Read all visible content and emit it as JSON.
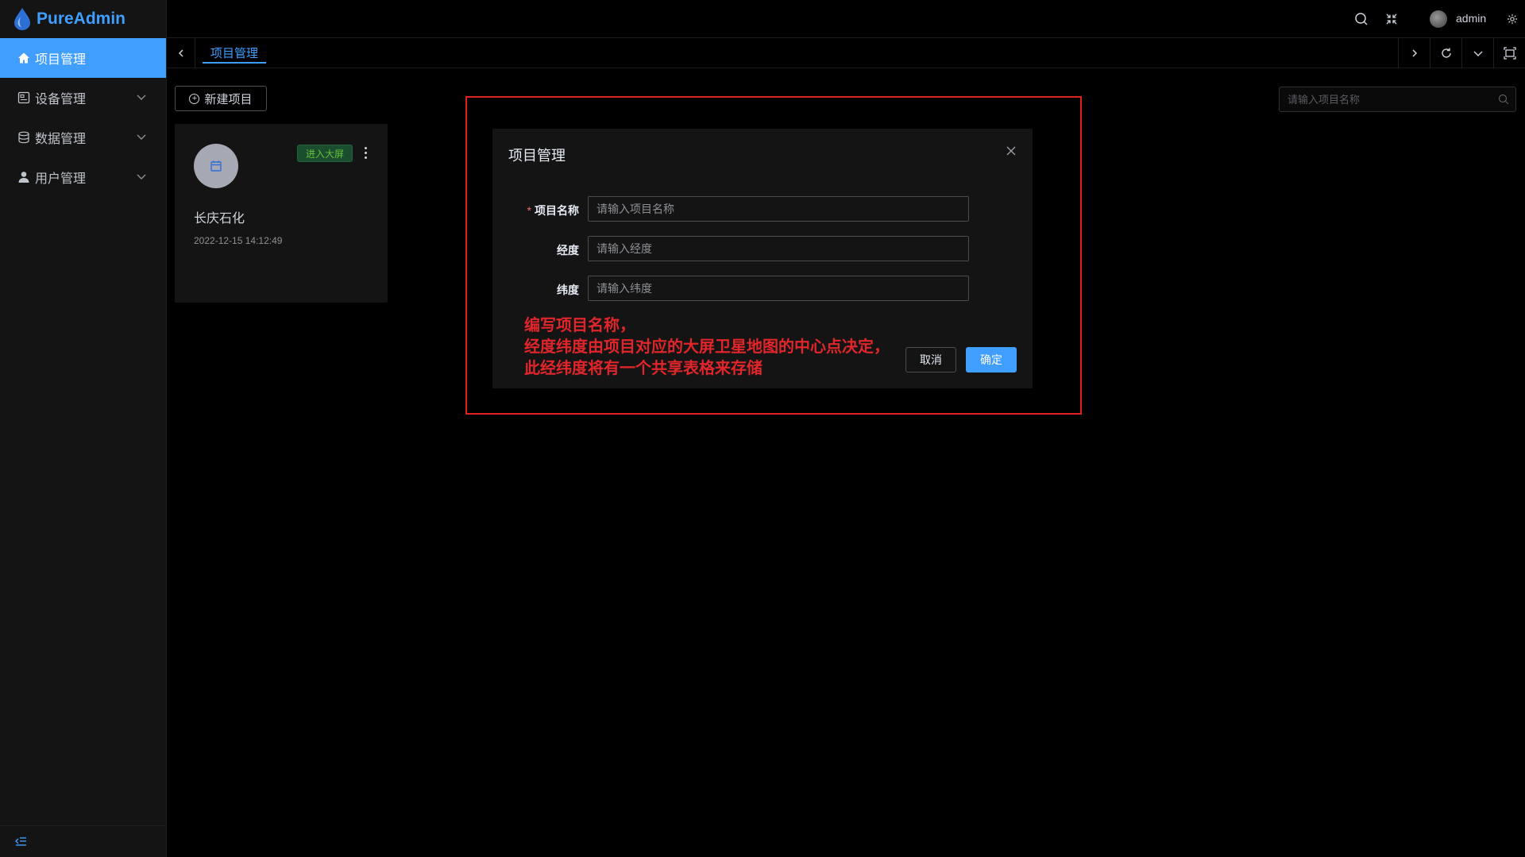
{
  "app": {
    "name": "PureAdmin"
  },
  "sidebar": {
    "items": [
      {
        "label": "项目管理",
        "icon": "home-icon",
        "active": true
      },
      {
        "label": "设备管理",
        "icon": "device-icon",
        "active": false
      },
      {
        "label": "数据管理",
        "icon": "database-icon",
        "active": false
      },
      {
        "label": "用户管理",
        "icon": "user-icon",
        "active": false
      }
    ]
  },
  "header": {
    "username": "admin"
  },
  "tabs": [
    {
      "label": "项目管理",
      "active": true
    }
  ],
  "toolbar": {
    "new_project_label": "新建项目"
  },
  "search": {
    "placeholder": "请输入项目名称"
  },
  "project_card": {
    "tag": "进入大屏",
    "title": "长庆石化",
    "date": "2022-12-15 14:12:49"
  },
  "dialog": {
    "title": "项目管理",
    "fields": [
      {
        "label": "项目名称",
        "required": true,
        "placeholder": "请输入项目名称",
        "value": ""
      },
      {
        "label": "经度",
        "required": false,
        "placeholder": "请输入经度",
        "value": ""
      },
      {
        "label": "纬度",
        "required": false,
        "placeholder": "请输入纬度",
        "value": ""
      }
    ],
    "cancel_label": "取消",
    "confirm_label": "确定"
  },
  "annotation": {
    "lines": [
      "编写项目名称，",
      "经度纬度由项目对应的大屏卫星地图的中心点决定，",
      "此经纬度将有一个共享表格来存储"
    ]
  },
  "colors": {
    "accent": "#409eff",
    "annotation_red": "#e0262b",
    "tag_green": "#67c23a"
  }
}
